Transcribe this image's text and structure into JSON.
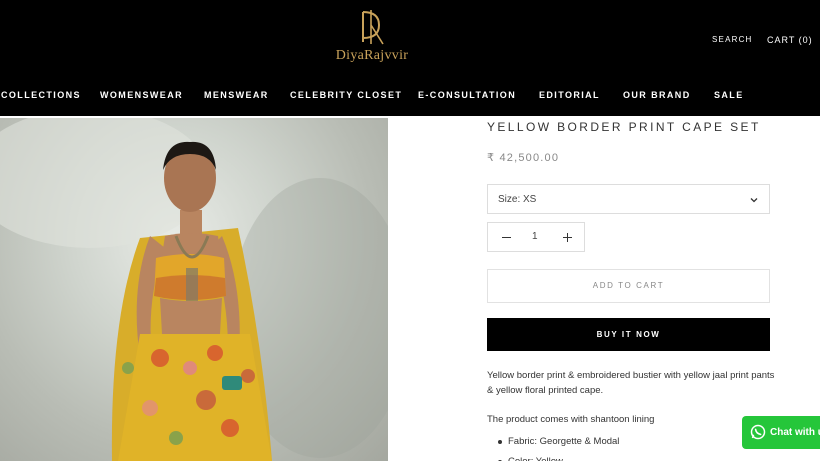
{
  "brand": {
    "name": "DiyaRajvvir",
    "logo_color": "#c9a25a"
  },
  "header": {
    "search_label": "SEARCH",
    "cart_label": "CART (0)"
  },
  "nav": {
    "items": [
      {
        "label": "COLLECTIONS"
      },
      {
        "label": "WOMENSWEAR"
      },
      {
        "label": "MENSWEAR"
      },
      {
        "label": "CELEBRITY CLOSET"
      },
      {
        "label": "E-CONSULTATION"
      },
      {
        "label": "EDITORIAL"
      },
      {
        "label": "OUR BRAND"
      },
      {
        "label": "SALE"
      }
    ]
  },
  "product": {
    "title": "YELLOW BORDER PRINT CAPE SET",
    "price": "₹ 42,500.00",
    "size_label": "Size: XS",
    "quantity": "1",
    "add_to_cart_label": "ADD TO CART",
    "buy_now_label": "BUY IT NOW",
    "description": "Yellow border print & embroidered bustier with yellow jaal print pants & yellow floral printed cape.",
    "lining_text": "The product comes with shantoon lining",
    "specs": [
      "Fabric: Georgette & Modal",
      "Color: Yellow"
    ]
  },
  "chat_widget": {
    "label": "Chat with us",
    "color": "#25c63a"
  },
  "icons": {
    "size_dropdown": "chevron-down-icon",
    "qty_minus": "minus-icon",
    "qty_plus": "plus-icon",
    "chat": "whatsapp-icon"
  }
}
